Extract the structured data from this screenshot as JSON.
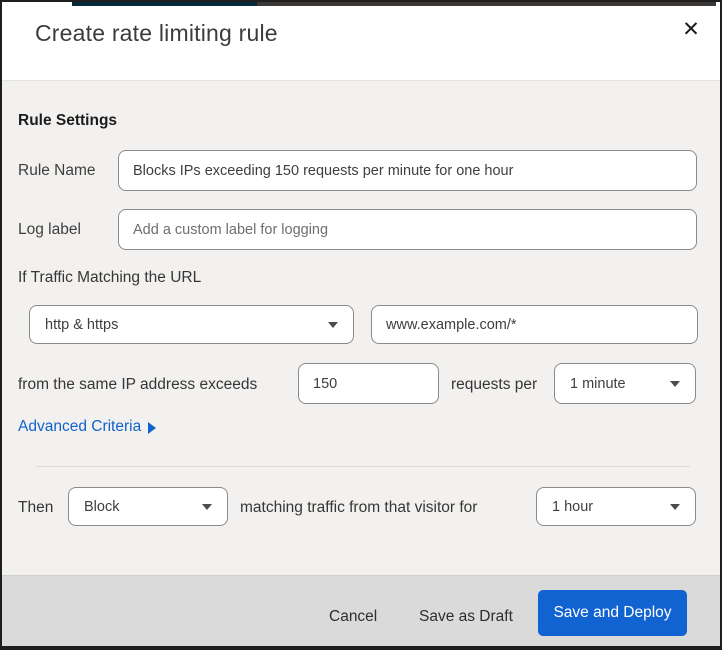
{
  "header": {
    "title": "Create rate limiting rule",
    "close_icon": "✕"
  },
  "rule_settings": {
    "heading": "Rule Settings",
    "rule_name_label": "Rule Name",
    "rule_name_value": "Blocks IPs exceeding 150 requests per minute for one hour",
    "log_label": "Log label",
    "log_placeholder": "Add a custom label for logging"
  },
  "match": {
    "heading": "If Traffic Matching the URL",
    "scheme_value": "http & https",
    "url_value": "www.example.com/*",
    "threshold_prefix": "from the same IP address exceeds",
    "threshold_value": "150",
    "threshold_unit": "requests per",
    "period_value": "1 minute",
    "advanced_label": "Advanced Criteria"
  },
  "action": {
    "then_label": "Then",
    "action_value": "Block",
    "middle_text": "matching traffic from that visitor for",
    "duration_value": "1 hour"
  },
  "footer": {
    "cancel_label": "Cancel",
    "save_draft_label": "Save as Draft",
    "save_deploy_label": "Save and Deploy"
  },
  "colors": {
    "primary_blue": "#1163d2",
    "link_blue": "#1262cb",
    "top_bar_navy": "#07283b",
    "top_bar_gray": "#3b3734",
    "body_background": "#f2f1ef",
    "footer_background": "#dadada"
  }
}
